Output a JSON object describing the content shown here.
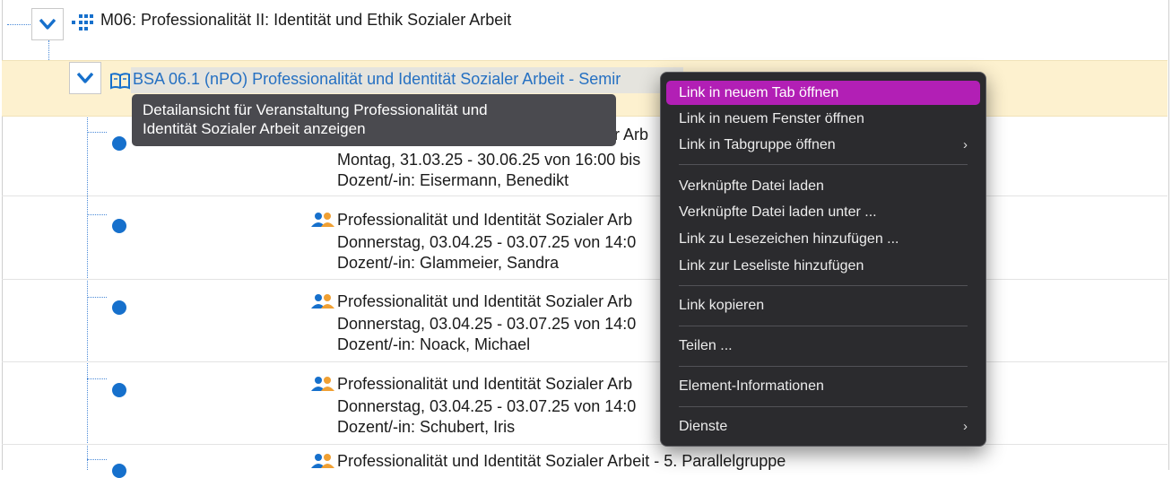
{
  "module": {
    "title": "M06: Professionalität II: Identität und Ethik Sozialer Arbeit"
  },
  "course": {
    "title": "BSA 06.1 (nPO) Professionalität und Identität Sozialer Arbeit - Semir"
  },
  "tooltip": {
    "line1": "Detailansicht für Veranstaltung Professionalität und",
    "line2": "Identität Sozialer Arbeit anzeigen"
  },
  "groups": [
    {
      "title": "Professionalität und Identität Sozialer Arb",
      "visible_title_tail": "er Arb",
      "schedule": "Montag, 31.03.25 - 30.06.25 von 16:00 bis",
      "lecturer": "Dozent/-in: Eisermann, Benedikt"
    },
    {
      "title": "Professionalität und Identität Sozialer Arb",
      "schedule": "Donnerstag, 03.04.25 - 03.07.25 von 14:0",
      "lecturer": "Dozent/-in: Glammeier, Sandra"
    },
    {
      "title": "Professionalität und Identität Sozialer Arb",
      "schedule": "Donnerstag, 03.04.25 - 03.07.25 von 14:0",
      "lecturer": "Dozent/-in: Noack, Michael"
    },
    {
      "title": "Professionalität und Identität Sozialer Arb",
      "schedule": "Donnerstag, 03.04.25 - 03.07.25 von 14:0",
      "lecturer": "Dozent/-in: Schubert, Iris"
    },
    {
      "title": "Professionalität und Identität Sozialer Arbeit - 5. Parallelgruppe"
    }
  ],
  "context_menu": {
    "items": [
      {
        "label": "Link in neuem Tab öffnen"
      },
      {
        "label": "Link in neuem Fenster öffnen"
      },
      {
        "label": "Link in Tabgruppe öffnen",
        "chevron": "›"
      },
      {
        "label": "Verknüpfte Datei laden"
      },
      {
        "label": "Verknüpfte Datei laden unter ..."
      },
      {
        "label": "Link zu Lesezeichen hinzufügen ..."
      },
      {
        "label": "Link zur Leseliste hinzufügen"
      },
      {
        "label": "Link kopieren"
      },
      {
        "label": "Teilen ..."
      },
      {
        "label": "Element-Informationen"
      },
      {
        "label": "Dienste",
        "chevron": "›"
      }
    ]
  },
  "colors": {
    "accent_blue": "#1670cc",
    "link_blue": "#2570c2",
    "highlight_row": "#fdf1cf",
    "menu_active": "#b21fb5",
    "menu_bg": "#2b2b2e",
    "tooltip_bg": "#4a4a4f"
  },
  "icons": [
    "chevron-down-icon",
    "module-grid-icon",
    "book-icon",
    "group-icon",
    "chevron-right-icon"
  ]
}
